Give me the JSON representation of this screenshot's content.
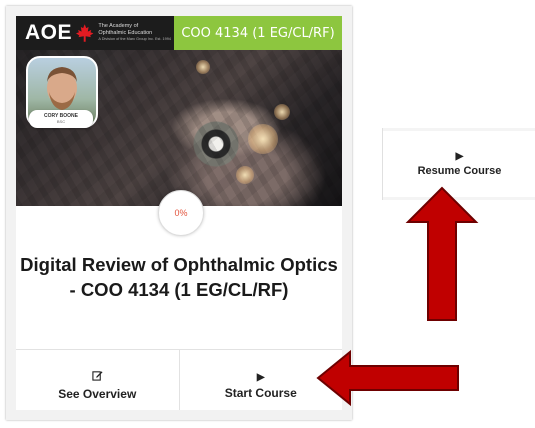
{
  "card": {
    "brand": {
      "logo_text": "AOE",
      "sub_line1": "The Academy of",
      "sub_line2": "Ophthalmic Education",
      "sub_line3": "A Division of the Marc Group Inc. Est. 1994"
    },
    "course_code": "COO 4134 (1 EG/CL/RF)",
    "instructor": {
      "name": "CORY BOONE",
      "role": "BSC"
    },
    "progress_label": "0%",
    "progress_value": 0,
    "title": "Digital Review of Ophthalmic Optics - COO 4134 (1 EG/CL/RF)",
    "actions": {
      "overview_icon": "edit-icon",
      "overview_label": "See Overview",
      "start_icon": "play-icon",
      "start_label": "Start Course"
    }
  },
  "resume": {
    "icon": "play-icon",
    "label": "Resume Course"
  },
  "annotations": {
    "arrow_color": "#c00000",
    "brand_green": "#8dc63f",
    "progress_color": "#e2543d"
  }
}
